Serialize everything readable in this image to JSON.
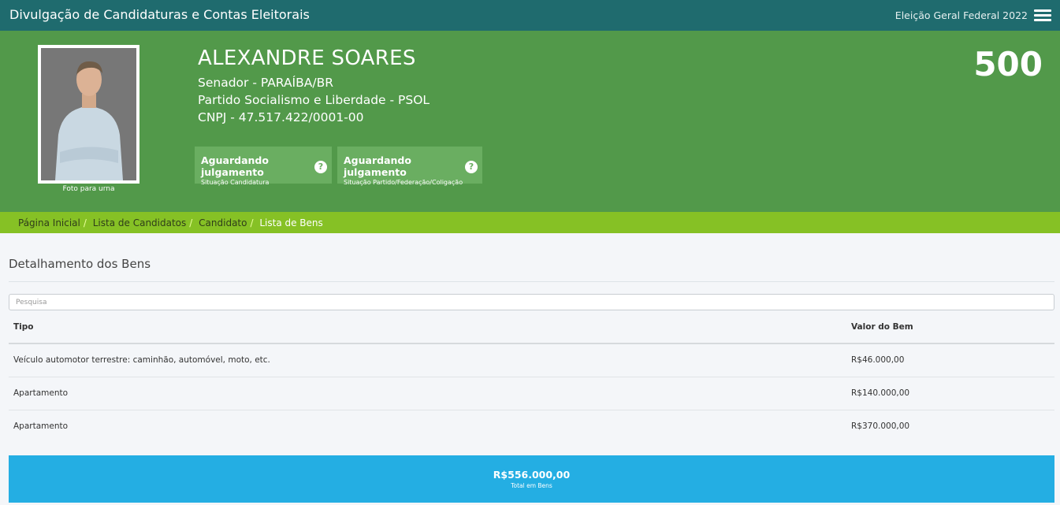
{
  "header": {
    "app_title": "Divulgação de Candidaturas e Contas Eleitorais",
    "election": "Eleição Geral Federal 2022",
    "menu_icon": "hamburger-menu-icon"
  },
  "candidate": {
    "name": "ALEXANDRE SOARES",
    "office": "Senador - PARAÍBA/BR",
    "party": "Partido Socialismo e Liberdade - PSOL",
    "cnpj": "CNPJ - 47.517.422/0001-00",
    "number": "500",
    "photo_caption": "Foto para urna"
  },
  "status": [
    {
      "title": "Aguardando julgamento",
      "subtitle": "Situação Candidatura",
      "icon": "question-icon"
    },
    {
      "title": "Aguardando julgamento",
      "subtitle": "Situação Partido/Federação/Coligação",
      "icon": "question-icon"
    }
  ],
  "breadcrumb": {
    "items": [
      "Página Inicial",
      "Lista de Candidatos",
      "Candidato",
      "Lista de Bens"
    ]
  },
  "assets": {
    "section_title": "Detalhamento dos Bens",
    "search_placeholder": "Pesquisa",
    "columns": [
      "Tipo",
      "Valor do Bem"
    ],
    "rows": [
      {
        "tipo": "Veículo automotor terrestre: caminhão, automóvel, moto, etc.",
        "valor": "R$46.000,00"
      },
      {
        "tipo": "Apartamento",
        "valor": "R$140.000,00"
      },
      {
        "tipo": "Apartamento",
        "valor": "R$370.000,00"
      }
    ],
    "total_value": "R$556.000,00",
    "total_label": "Total em Bens"
  },
  "colors": {
    "topbar": "#1f6b6e",
    "hero": "#52994a",
    "status_box": "#6aae61",
    "breadcrumb": "#86c125",
    "total_bar": "#24aee3"
  }
}
